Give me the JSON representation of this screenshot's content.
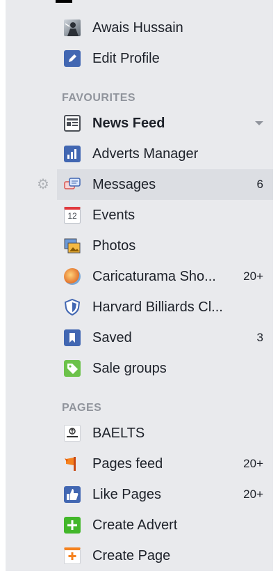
{
  "profile": {
    "name": "Awais Hussain",
    "edit_label": "Edit Profile"
  },
  "sections": {
    "favourites": "FAVOURITES",
    "pages": "PAGES"
  },
  "favourites": [
    {
      "label": "News Feed",
      "count": ""
    },
    {
      "label": "Adverts Manager",
      "count": ""
    },
    {
      "label": "Messages",
      "count": "6"
    },
    {
      "label": "Events",
      "count": ""
    },
    {
      "label": "Photos",
      "count": ""
    },
    {
      "label": "Caricaturama Sho...",
      "count": "20+"
    },
    {
      "label": "Harvard Billiards Cl...",
      "count": ""
    },
    {
      "label": "Saved",
      "count": "3"
    },
    {
      "label": "Sale groups",
      "count": ""
    }
  ],
  "events_icon_day": "12",
  "pages": [
    {
      "label": "BAELTS",
      "count": ""
    },
    {
      "label": "Pages feed",
      "count": "20+"
    },
    {
      "label": "Like Pages",
      "count": "20+"
    },
    {
      "label": "Create Advert",
      "count": ""
    },
    {
      "label": "Create Page",
      "count": ""
    }
  ],
  "colors": {
    "panel_bg": "#e9eaed",
    "active_row": "#dcdee3",
    "section_text": "#90949c",
    "text": "#1d2129",
    "facebook_blue": "#4267b2"
  }
}
